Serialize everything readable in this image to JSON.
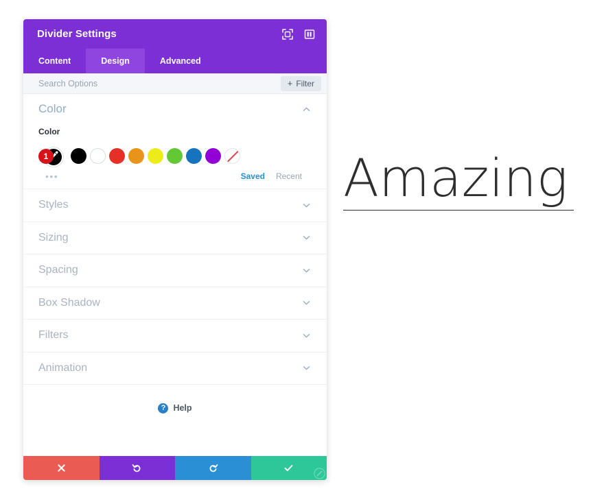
{
  "panel": {
    "title": "Divider Settings",
    "header_icons": [
      {
        "name": "fullscreen-icon",
        "label": "Fullscreen"
      },
      {
        "name": "layout-toggle-icon",
        "label": "Panel Layout"
      }
    ],
    "tabs": [
      {
        "label": "Content",
        "active": false
      },
      {
        "label": "Design",
        "active": true
      },
      {
        "label": "Advanced",
        "active": false
      }
    ],
    "search": {
      "value": "",
      "placeholder": "Search Options"
    },
    "filter_button": {
      "label": "Filter",
      "plus": "+"
    },
    "color_section": {
      "title": "Color",
      "expanded": true,
      "field_label": "Color",
      "selected": {
        "badge_count": "1",
        "value": "#000000",
        "icon": "eyedropper-icon"
      },
      "swatches": [
        {
          "name": "swatch-black",
          "color": "#000000",
          "bordered": false
        },
        {
          "name": "swatch-white",
          "color": "#ffffff",
          "bordered": true
        },
        {
          "name": "swatch-red",
          "color": "#e63027",
          "bordered": false
        },
        {
          "name": "swatch-orange",
          "color": "#e8941a",
          "bordered": false
        },
        {
          "name": "swatch-yellow",
          "color": "#edec1b",
          "bordered": false
        },
        {
          "name": "swatch-green",
          "color": "#62c833",
          "bordered": false
        },
        {
          "name": "swatch-blue",
          "color": "#1574bd",
          "bordered": false
        },
        {
          "name": "swatch-purple",
          "color": "#9300d6",
          "bordered": false
        },
        {
          "name": "swatch-transparent",
          "color": "transparent",
          "bordered": true
        }
      ],
      "more_dots": "•••",
      "links": [
        {
          "label": "Saved",
          "active": true
        },
        {
          "label": "Recent",
          "active": false
        }
      ]
    },
    "sections": [
      {
        "label": "Styles"
      },
      {
        "label": "Sizing"
      },
      {
        "label": "Spacing"
      },
      {
        "label": "Box Shadow"
      },
      {
        "label": "Filters"
      },
      {
        "label": "Animation"
      }
    ],
    "help": {
      "label": "Help",
      "icon_glyph": "?"
    },
    "actions": [
      {
        "name": "cancel-button",
        "icon": "close-icon",
        "color": "#ea5b54"
      },
      {
        "name": "undo-button",
        "icon": "undo-icon",
        "color": "#7b2fd4"
      },
      {
        "name": "redo-button",
        "icon": "redo-icon",
        "color": "#2a8fd4"
      },
      {
        "name": "save-button",
        "icon": "checkmark-icon",
        "color": "#2dc79a"
      }
    ]
  },
  "preview": {
    "heading": "Amazing"
  },
  "colors": {
    "header_purple": "#7b2fd4",
    "tab_active_purple": "#8f45e0",
    "accent_blue": "#2a8fd4",
    "badge_red": "#d6131a"
  }
}
